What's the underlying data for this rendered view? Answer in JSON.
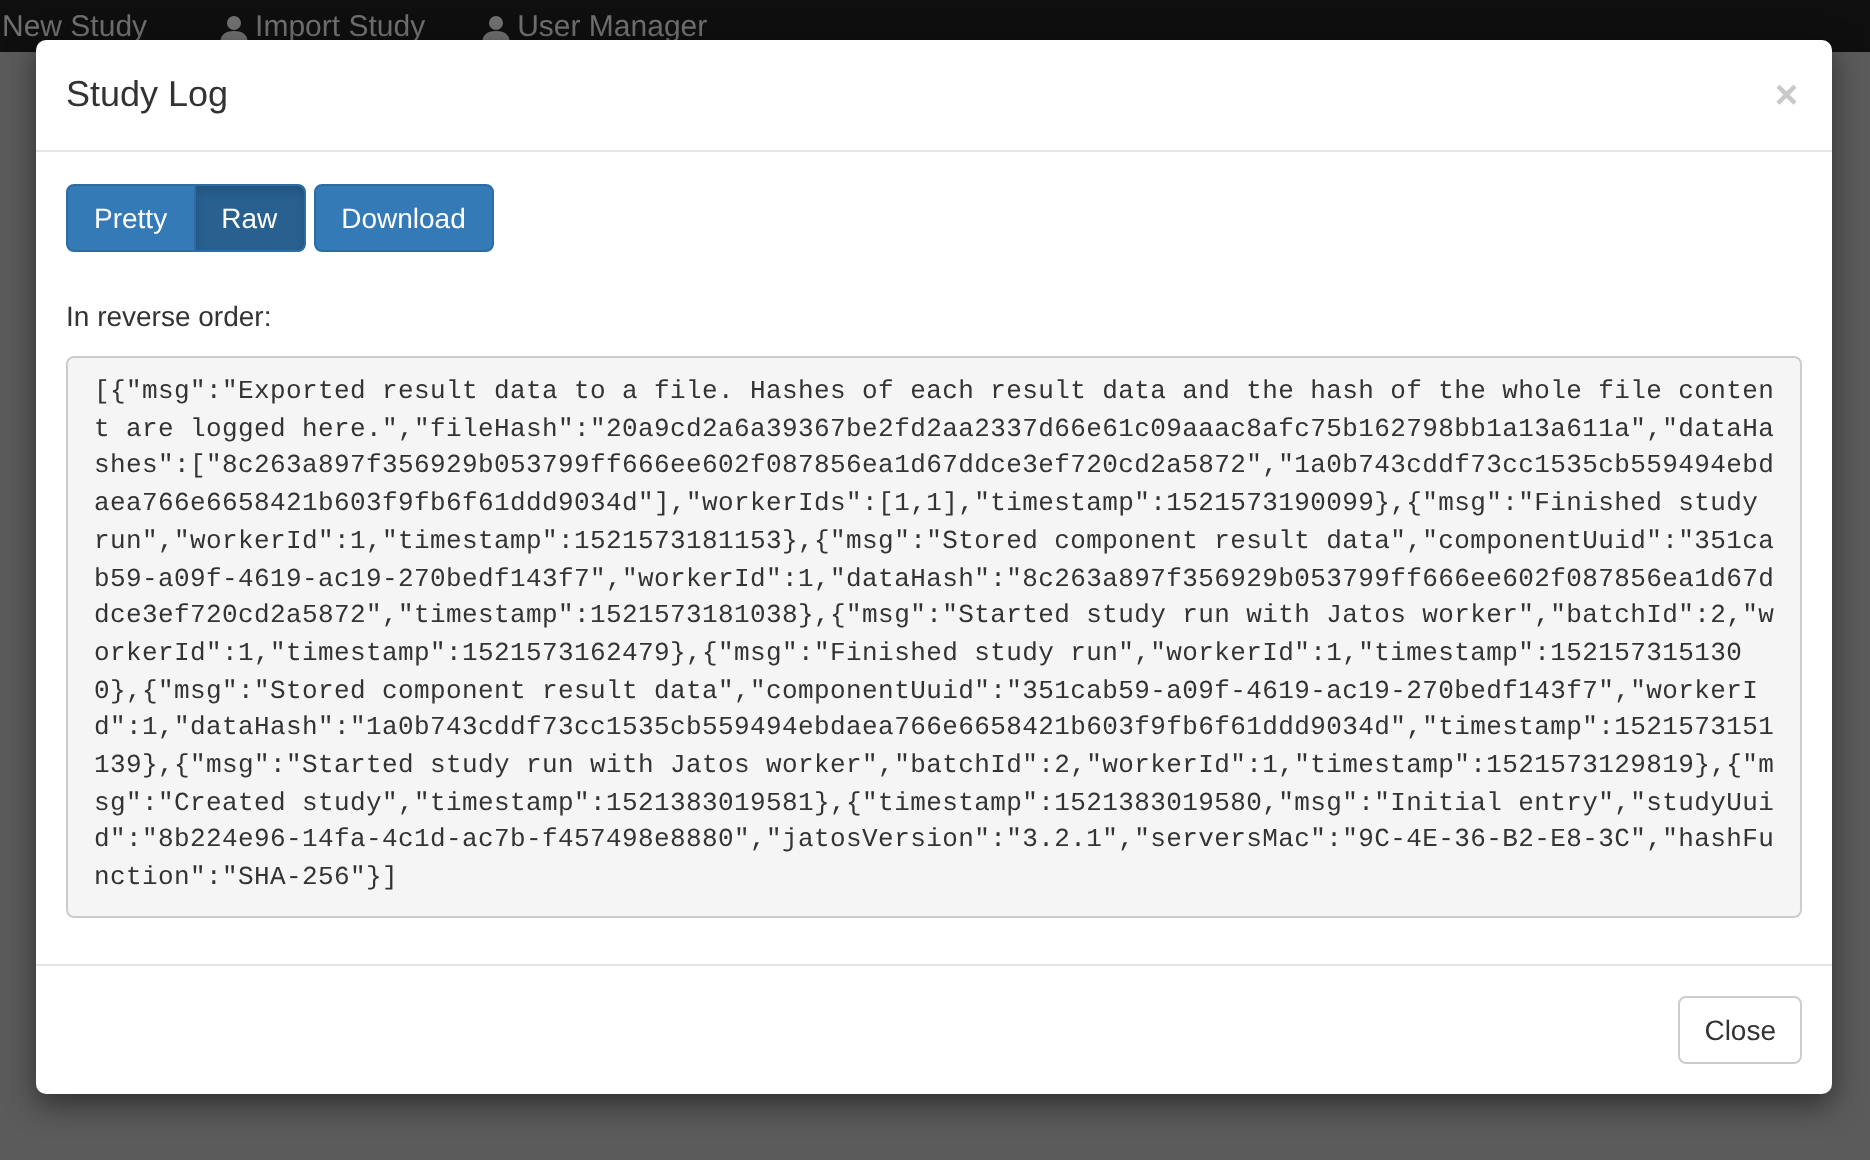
{
  "navbar": {
    "items": [
      {
        "label": "New Study",
        "icon": false
      },
      {
        "label": "Import Study",
        "icon": true
      },
      {
        "label": "User Manager",
        "icon": true
      }
    ]
  },
  "dialog": {
    "title": "Study Log",
    "close_symbol": "×",
    "view_toggle": [
      {
        "label": "Pretty",
        "selected": false
      },
      {
        "label": "Raw",
        "selected": true
      }
    ],
    "download_button": "Download",
    "caption": "In reverse order:",
    "log_text": "[{\"msg\":\"Exported result data to a file. Hashes of each result data and the hash of the whole file content are logged here.\",\"fileHash\":\"20a9cd2a6a39367be2fd2aa2337d66e61c09aaac8afc75b162798bb1a13a611a\",\"dataHashes\":[\"8c263a897f356929b053799ff666ee602f087856ea1d67ddce3ef720cd2a5872\",\"1a0b743cddf73cc1535cb559494ebdaea766e6658421b603f9fb6f61ddd9034d\"],\"workerIds\":[1,1],\"timestamp\":1521573190099},{\"msg\":\"Finished study run\",\"workerId\":1,\"timestamp\":1521573181153},{\"msg\":\"Stored component result data\",\"componentUuid\":\"351cab59-a09f-4619-ac19-270bedf143f7\",\"workerId\":1,\"dataHash\":\"8c263a897f356929b053799ff666ee602f087856ea1d67ddce3ef720cd2a5872\",\"timestamp\":1521573181038},{\"msg\":\"Started study run with Jatos worker\",\"batchId\":2,\"workerId\":1,\"timestamp\":1521573162479},{\"msg\":\"Finished study run\",\"workerId\":1,\"timestamp\":1521573151300},{\"msg\":\"Stored component result data\",\"componentUuid\":\"351cab59-a09f-4619-ac19-270bedf143f7\",\"workerId\":1,\"dataHash\":\"1a0b743cddf73cc1535cb559494ebdaea766e6658421b603f9fb6f61ddd9034d\",\"timestamp\":1521573151139},{\"msg\":\"Started study run with Jatos worker\",\"batchId\":2,\"workerId\":1,\"timestamp\":1521573129819},{\"msg\":\"Created study\",\"timestamp\":1521383019581},{\"timestamp\":1521383019580,\"msg\":\"Initial entry\",\"studyUuid\":\"8b224e96-14fa-4c1d-ac7b-f457498e8880\",\"jatosVersion\":\"3.2.1\",\"serversMac\":\"9C-4E-36-B2-E8-3C\",\"hashFunction\":\"SHA-256\"}]",
    "footer_button": "Close"
  }
}
